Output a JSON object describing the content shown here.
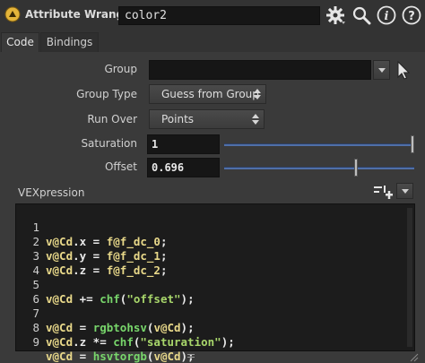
{
  "header": {
    "node_type": "Attribute Wrangle",
    "node_name": "color2",
    "icons": [
      "wrangle-node-icon",
      "gear-icon",
      "search-icon",
      "info-icon",
      "help-icon"
    ]
  },
  "tabs": [
    {
      "label": "Code",
      "active": true
    },
    {
      "label": "Bindings",
      "active": false
    }
  ],
  "params": {
    "group": {
      "label": "Group",
      "value": ""
    },
    "group_type": {
      "label": "Group Type",
      "value": "Guess from Group"
    },
    "run_over": {
      "label": "Run Over",
      "value": "Points"
    },
    "saturation": {
      "label": "Saturation",
      "value": "1",
      "slider_fraction": 1.0
    },
    "offset": {
      "label": "Offset",
      "value": "0.696",
      "slider_fraction": 0.696
    }
  },
  "vex": {
    "label": "VEXpression",
    "lines": [
      {
        "num": "1"
      },
      {
        "num": "2"
      },
      {
        "num": "3"
      },
      {
        "num": "4"
      },
      {
        "num": "5"
      },
      {
        "num": "6"
      },
      {
        "num": "7"
      },
      {
        "num": "8"
      },
      {
        "num": "9"
      }
    ],
    "tokens": {
      "l1": [
        "v@Cd",
        ".x = ",
        "f@f_dc_0",
        ";"
      ],
      "l2": [
        "v@Cd",
        ".y = ",
        "f@f_dc_1",
        ";"
      ],
      "l3": [
        "v@Cd",
        ".z = ",
        "f@f_dc_2",
        ";"
      ],
      "l5": [
        "v@Cd",
        " += ",
        "chf",
        "(",
        "\"offset\"",
        ");"
      ],
      "l7": [
        "v@Cd",
        " = ",
        "rgbtohsv",
        "(",
        "v@Cd",
        ");"
      ],
      "l8": [
        "v@Cd",
        ".z *= ",
        "chf",
        "(",
        "\"saturation\"",
        ");"
      ],
      "l9": [
        "v@Cd",
        " = ",
        "hsvtorgb",
        "(",
        "v@Cd",
        ");"
      ]
    }
  },
  "colors": {
    "attribute": "#e9d98a",
    "function": "#78d66b",
    "string": "#a8d66b",
    "slider": "#4f6fa8"
  }
}
